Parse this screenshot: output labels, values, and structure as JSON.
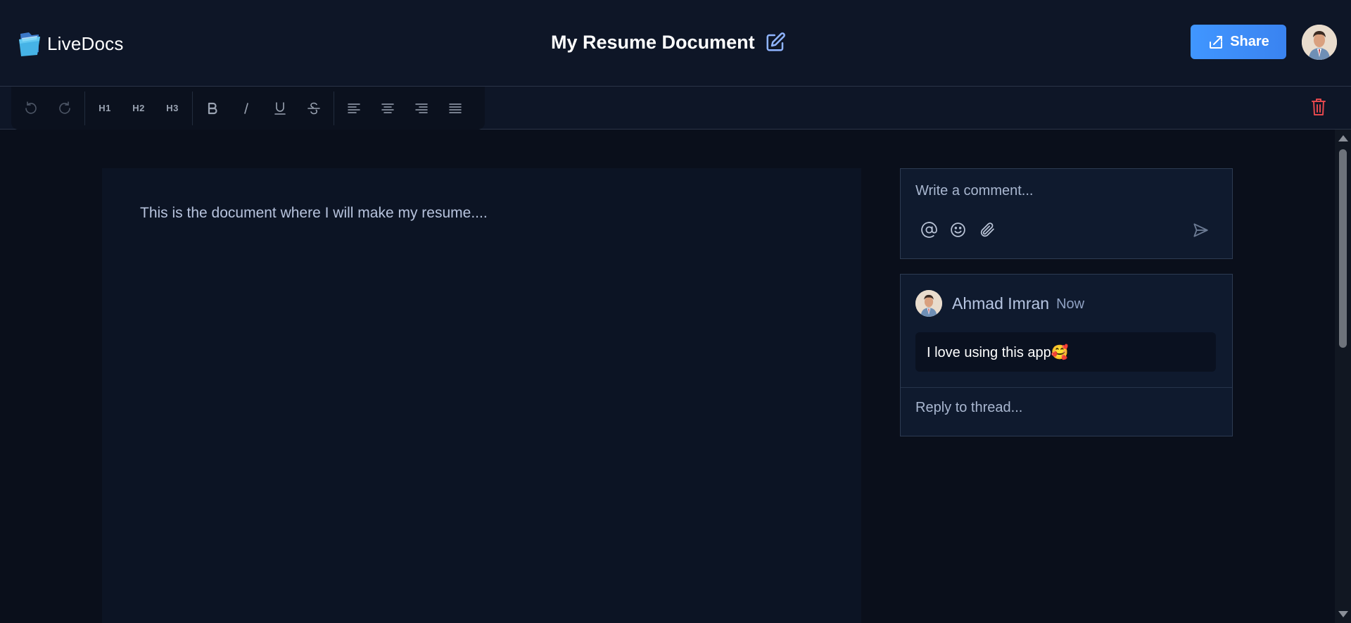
{
  "app": {
    "name": "LiveDocs"
  },
  "document": {
    "title": "My Resume Document",
    "content": "This is the document where I will make my resume...."
  },
  "header": {
    "share_label": "Share"
  },
  "toolbar": {
    "undo_icon": "undo-icon",
    "redo_icon": "redo-icon",
    "h1_label": "H1",
    "h2_label": "H2",
    "h3_label": "H3",
    "bold_icon": "bold-icon",
    "italic_icon": "italic-icon",
    "underline_icon": "underline-icon",
    "strike_icon": "strikethrough-icon",
    "align_icons": [
      "align-left-icon",
      "align-center-icon",
      "align-right-icon",
      "align-justify-icon"
    ],
    "delete_icon": "trash-icon"
  },
  "composer": {
    "placeholder": "Write a comment...",
    "icons": [
      "mention-icon",
      "emoji-icon",
      "attachment-icon",
      "send-icon"
    ]
  },
  "thread": {
    "author": "Ahmad Imran",
    "time": "Now",
    "message": "I love using this app🥰",
    "reply_placeholder": "Reply to thread..."
  },
  "colors": {
    "accent": "#3a8dff",
    "danger": "#e5484d",
    "background": "#0a0f1b",
    "panel": "#0f1a2e"
  }
}
